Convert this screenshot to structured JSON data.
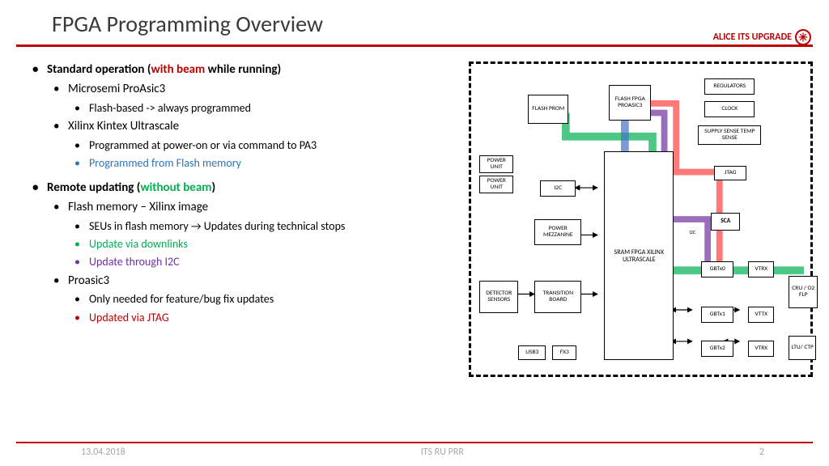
{
  "title": "FPGA Programming Overview",
  "brand": "ALICE ITS UPGRADE",
  "bullets": {
    "std_title_a": "Standard operation (",
    "std_title_b": "with beam",
    "std_title_c": " while running)",
    "microsemi": "Microsemi ProAsic3",
    "flashbased": "Flash-based -> always programmed",
    "xilinx": "Xilinx Kintex Ultrascale",
    "poweron": "Programmed at power-on or via command to PA3",
    "fromflash": "Programmed from Flash memory",
    "remote_a": "Remote updating (",
    "remote_b": "without beam",
    "remote_c": ")",
    "flashmem": "Flash memory – Xilinx image",
    "seus": "SEUs in flash memory → Updates during technical stops",
    "downlinks": "Update via downlinks",
    "i2c": "Update through I2C",
    "proasic": "Proasic3",
    "feature": "Only needed for feature/bug fix updates",
    "jtag": "Updated via JTAG"
  },
  "diagram": {
    "flash_prom": "FLASH PROM",
    "flash_fpga": "FLASH FPGA PROASIC3",
    "regulators": "REGULATORS",
    "clock": "CLOCK",
    "sense": "SUPPLY SENSE TEMP SENSE",
    "power_unit": "POWER UNIT",
    "i2c": "I2C",
    "jtag": "JTAG",
    "mezz": "POWER MEZZANINE",
    "sca": "SCA",
    "i2c_small": "I2C",
    "sram": "SRAM FPGA XILINX ULTRASCALE",
    "gbtx0": "GBTx0",
    "vtrx": "VTRX",
    "detector": "DETECTOR SENSORS",
    "transition": "TRANSITION BOARD",
    "cru": "CRU / O2 FLP",
    "gbtx1": "GBTx1",
    "vttx": "VTTX",
    "usb3": "USB3",
    "fx3": "FX3",
    "gbtx2": "GBTx2",
    "vtrx2": "VTRX",
    "ltu": "LTU/ CTP"
  },
  "footer": {
    "date": "13.04.2018",
    "center": "ITS RU PRR",
    "page": "2"
  }
}
